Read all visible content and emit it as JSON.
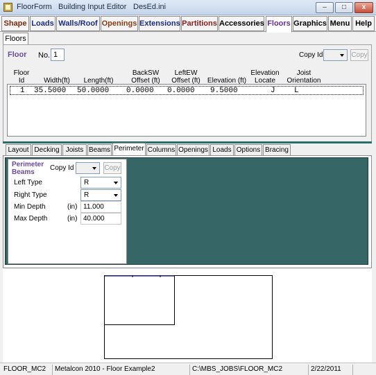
{
  "window": {
    "title_parts": [
      "FloorForm",
      "Building Input Editor",
      "DesEd.ini"
    ],
    "minimize": "–",
    "maximize": "□",
    "close": "x"
  },
  "menu": [
    {
      "label": "Shape",
      "color": "#7a2a10"
    },
    {
      "label": "Loads",
      "color": "#1a2a8c"
    },
    {
      "label": "Walls/Roof",
      "color": "#1a2a8c"
    },
    {
      "label": "Openings",
      "color": "#8c3a10"
    },
    {
      "label": "Extensions",
      "color": "#1a2a8c"
    },
    {
      "label": "Partitions",
      "color": "#8c1a1a"
    },
    {
      "label": "Accessories",
      "color": "#000000"
    },
    {
      "label": "Floors",
      "color": "#6a2a9c",
      "active": true
    },
    {
      "label": "Graphics",
      "color": "#000000"
    },
    {
      "label": "Menu",
      "color": "#000000"
    },
    {
      "label": "Help",
      "color": "#000000"
    }
  ],
  "floors_tab": "Floors",
  "floor": {
    "heading": "Floor",
    "no_label": "No.",
    "no_value": "1",
    "copy_id_label": "Copy Id",
    "copy_button": "Copy"
  },
  "table": {
    "headers": [
      [
        "Floor",
        "Id"
      ],
      [
        "Width(ft)"
      ],
      [
        "Length(ft)"
      ],
      [
        "BackSW",
        "Offset (ft)"
      ],
      [
        "LeftEW",
        "Offset (ft)"
      ],
      [
        "Elevation (ft)"
      ],
      [
        "Elevation",
        "Locate"
      ],
      [
        "Joist",
        "Orientation"
      ]
    ],
    "rows": [
      [
        "1",
        "35.5000",
        "50.0000",
        "0.0000",
        "0.0000",
        "9.5000",
        "J",
        "L"
      ]
    ]
  },
  "lower_tabs": [
    "Layout",
    "Decking",
    "Joists",
    "Beams",
    "Perimeter",
    "Columns",
    "Openings",
    "Loads",
    "Options",
    "Bracing"
  ],
  "active_lower_tab": "Perimeter",
  "perimeter": {
    "heading_line1": "Perimeter",
    "heading_line2": "Beams",
    "copy_id_label": "Copy Id",
    "copy_button": "Copy",
    "left_type_label": "Left Type",
    "left_type_value": "R",
    "right_type_label": "Right Type",
    "right_type_value": "R",
    "min_depth_label": "Min Depth",
    "min_depth_unit": "(in)",
    "min_depth_value": "11.000",
    "max_depth_label": "Max Depth",
    "max_depth_unit": "(in)",
    "max_depth_value": "40.000"
  },
  "status": {
    "job": "FLOOR_MC2",
    "description": "Metalcon 2010 - Floor Example2",
    "path": "C:\\MBS_JOBS\\FLOOR_MC2",
    "date": "2/22/2011"
  }
}
